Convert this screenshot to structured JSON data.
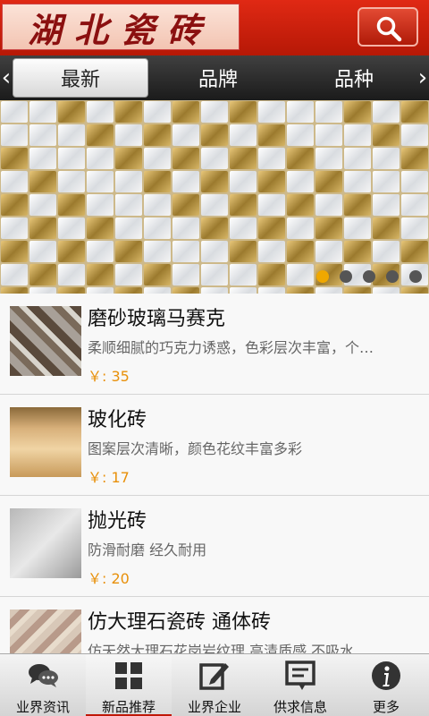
{
  "header": {
    "logo_text": "湖北瓷砖",
    "search_icon": "search-icon"
  },
  "tabs": {
    "items": [
      {
        "label": "最新"
      },
      {
        "label": "品牌"
      },
      {
        "label": "品种"
      }
    ],
    "left_arrow": "‹",
    "right_arrow": "›"
  },
  "banner": {
    "pages": 5,
    "current_page": 1
  },
  "products": [
    {
      "title": "磨砂玻璃马赛克",
      "desc": "柔顺细腻的巧克力诱惑，色彩层次丰富，个…",
      "price": "￥: 35"
    },
    {
      "title": "玻化砖",
      "desc": "图案层次清晰，颜色花纹丰富多彩",
      "price": "￥: 17"
    },
    {
      "title": "抛光砖",
      "desc": "防滑耐磨 经久耐用",
      "price": "￥: 20"
    },
    {
      "title": "仿大理石瓷砖 通体砖",
      "desc": "仿天然大理石花岗岩纹理 高清质感 不吸水",
      "price": ""
    }
  ],
  "bottom_nav": [
    {
      "label": "业界资讯",
      "icon": "chat-bubbles-icon"
    },
    {
      "label": "新品推荐",
      "icon": "grid-icon"
    },
    {
      "label": "业界企业",
      "icon": "edit-icon"
    },
    {
      "label": "供求信息",
      "icon": "message-box-icon"
    },
    {
      "label": "更多",
      "icon": "info-icon"
    }
  ],
  "colors": {
    "header_red": "#c81f0b",
    "price_orange": "#e8900a",
    "active_dot": "#f0a800"
  }
}
